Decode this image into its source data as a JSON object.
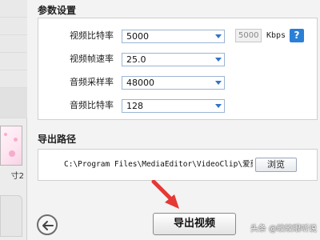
{
  "left_strip": {
    "thumbnail_caption": "寸2"
  },
  "params": {
    "title": "参数设置",
    "rows": [
      {
        "label": "视频比特率",
        "value": "5000"
      },
      {
        "label": "视频帧速率",
        "value": "25.0"
      },
      {
        "label": "音频采样率",
        "value": "48000"
      },
      {
        "label": "音频比特率",
        "value": "128"
      }
    ],
    "custom_bitrate_value": "5000",
    "bitrate_unit": "Kbps",
    "help_label": "?"
  },
  "export_path": {
    "title": "导出路径",
    "path": "C:\\Program Files\\MediaEditor\\VideoClip\\爱剪",
    "browse_label": "浏览"
  },
  "footer": {
    "export_label": "导出视频"
  },
  "watermark": {
    "prefix": "头条",
    "user": "@皎皎眼听说"
  },
  "colors": {
    "accent": "#2f75c6",
    "annotation_arrow": "#e53935"
  },
  "icons": {
    "back": "arrow-left-icon",
    "dropdown": "chevron-down-icon",
    "help": "question-icon"
  }
}
